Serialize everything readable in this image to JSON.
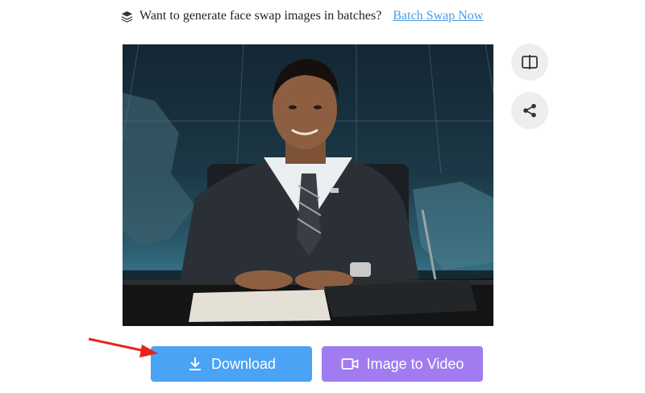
{
  "promo": {
    "icon": "layers-icon",
    "text": "Want to generate face swap images in batches?",
    "link_label": "Batch Swap Now",
    "link_color": "#4a9be8"
  },
  "result_image": {
    "alt": "Face swap result: woman in dark suit seated at a desk"
  },
  "side_actions": {
    "compare_icon": "compare-split-icon",
    "share_icon": "share-icon"
  },
  "actions": {
    "download_label": "Download",
    "download_icon": "download-icon",
    "download_color": "#4aa3f4",
    "video_label": "Image to Video",
    "video_icon": "video-camera-icon",
    "video_color": "#a07cf0"
  },
  "annotation": {
    "arrow_color": "#e8231d"
  }
}
